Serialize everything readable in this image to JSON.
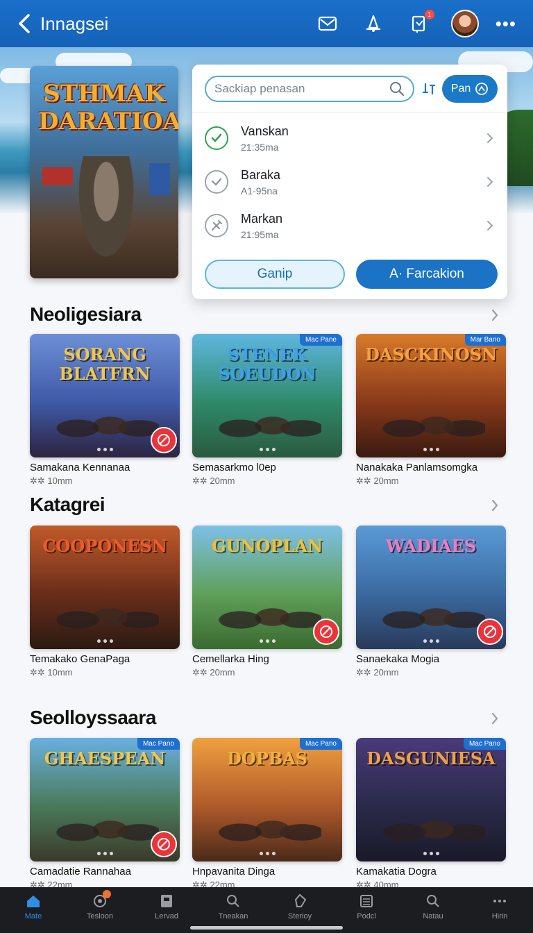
{
  "header": {
    "title": "Innagsei",
    "notification_badge": "1"
  },
  "featured": {
    "title": "STHMAK DARATIOA"
  },
  "panel": {
    "search_placeholder": "Sackiap penasan",
    "pan_button": "Pan",
    "items": [
      {
        "name": "Vanskan",
        "sub": "21:35ma",
        "icon": "check-circle-icon"
      },
      {
        "name": "Baraka",
        "sub": "A1-95na",
        "icon": "check-outline-icon"
      },
      {
        "name": "Markan",
        "sub": "21:95ma",
        "icon": "tools-icon"
      }
    ],
    "btn_secondary": "Ganip",
    "btn_primary": "A· Farcakion"
  },
  "sections": [
    {
      "title": "Neoligesiara",
      "cards": [
        {
          "thumb_title": "SORANG BLATFRN",
          "name": "Samakana Kennanaa",
          "meta": "✲✲ 10mm",
          "tag": "",
          "badge": true,
          "colors": [
            "#6d8fd6",
            "#3f5aa8",
            "#2d2440"
          ],
          "title_color": "#f2c64a"
        },
        {
          "thumb_title": "STENEK SOEUDON",
          "name": "Semasarkmo l0ep",
          "meta": "✲✲ 20mm",
          "tag": "Mac Pane",
          "badge": false,
          "colors": [
            "#5fb7e0",
            "#2f8a6a",
            "#2a5a40"
          ],
          "title_color": "#3fa0f0"
        },
        {
          "thumb_title": "DASCKINOSN",
          "name": "Nanakaka Panlamsomgka",
          "meta": "✲✲ 20mm",
          "tag": "Mar Bano",
          "badge": false,
          "colors": [
            "#d87a2a",
            "#8a3a1a",
            "#3a1a10"
          ],
          "title_color": "#f7a040"
        }
      ]
    },
    {
      "title": "Katagrei",
      "cards": [
        {
          "thumb_title": "COOPONESN",
          "name": "Temakako GenaPaga",
          "meta": "✲✲ 10mm",
          "tag": "",
          "badge": false,
          "colors": [
            "#c05a2a",
            "#6a2e1a",
            "#2a1a12"
          ],
          "title_color": "#f05a2a"
        },
        {
          "thumb_title": "GUNOPLAN",
          "name": "Cemellarka Hing",
          "meta": "✲✲ 20mm",
          "tag": "",
          "badge": true,
          "colors": [
            "#7ec0e8",
            "#5fa05a",
            "#3a6a30"
          ],
          "title_color": "#f2c030"
        },
        {
          "thumb_title": "WADIAES",
          "name": "Sanaekaka Mogia",
          "meta": "✲✲ 20mm",
          "tag": "",
          "badge": true,
          "colors": [
            "#5a9ad6",
            "#3a6aa0",
            "#2a3a5a"
          ],
          "title_color": "#f07ac0"
        }
      ]
    },
    {
      "title": "Seolloyssaara",
      "cards": [
        {
          "thumb_title": "GHAESPEAN",
          "name": "Camadatie Rannahaa",
          "meta": "✲✲ 22mm",
          "tag": "Mac Pano",
          "badge": true,
          "colors": [
            "#6ab0e0",
            "#4a7a5a",
            "#3a3a2a"
          ],
          "title_color": "#f2c64a"
        },
        {
          "thumb_title": "DOPBAS",
          "name": "Hnpavanita Dinga",
          "meta": "✲✲ 22mm",
          "tag": "Mac Pano",
          "badge": false,
          "colors": [
            "#f0a040",
            "#b05a2a",
            "#4a2a1a"
          ],
          "title_color": "#f2b040"
        },
        {
          "thumb_title": "DASGUNIESA",
          "name": "Kamakatia Dogra",
          "meta": "✲✲ 40mm",
          "tag": "Mac Pano",
          "badge": false,
          "colors": [
            "#4a3a7a",
            "#2a2a4a",
            "#1a1a2a"
          ],
          "title_color": "#f2a040"
        }
      ]
    }
  ],
  "bottom_nav": [
    {
      "label": "Mate",
      "icon": "home-icon",
      "active": true
    },
    {
      "label": "Tesloon",
      "icon": "gamepad-icon",
      "active": false,
      "dot": true
    },
    {
      "label": "Lervad",
      "icon": "store-icon",
      "active": false
    },
    {
      "label": "Tneakan",
      "icon": "search-icon",
      "active": false
    },
    {
      "label": "Sterioy",
      "icon": "star-icon",
      "active": false
    },
    {
      "label": "Podcl",
      "icon": "list-icon",
      "active": false
    },
    {
      "label": "Natau",
      "icon": "search-icon",
      "active": false
    },
    {
      "label": "Hirin",
      "icon": "more-icon",
      "active": false
    }
  ]
}
